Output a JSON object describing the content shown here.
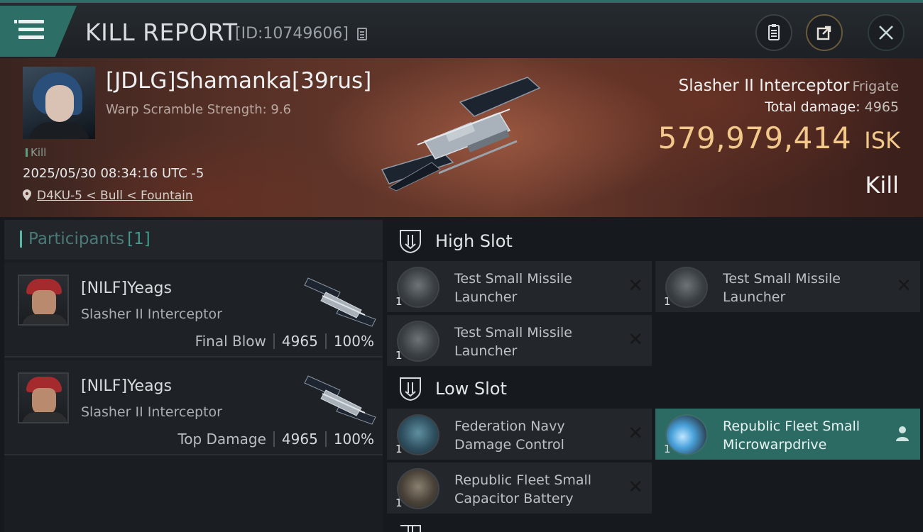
{
  "header": {
    "title": "KILL REPORT",
    "report_id": "[ID:10749606]",
    "icons": [
      "menu-icon",
      "copy-icon",
      "notes-icon",
      "share-icon",
      "close-icon"
    ]
  },
  "victim": {
    "name": "[JDLG]Shamanka[39rus]",
    "warp_scramble": "Warp Scramble Strength: 9.6",
    "kill_label": "Kill",
    "timestamp": "2025/05/30 08:34:16 UTC -5",
    "location": "D4KU-5 < Bull < Fountain"
  },
  "ship": {
    "name": "Slasher II Interceptor",
    "class": "Frigate",
    "total_damage_label": "Total damage:",
    "total_damage": "4965",
    "isk_value": "579,979,414",
    "isk_unit": "ISK",
    "kill_type": "Kill"
  },
  "participants": {
    "title": "Participants",
    "count": "[1]",
    "items": [
      {
        "name": "[NILF]Yeags",
        "ship": "Slasher II Interceptor",
        "role": "Final Blow",
        "damage": "4965",
        "percent": "100%"
      },
      {
        "name": "[NILF]Yeags",
        "ship": "Slasher II Interceptor",
        "role": "Top Damage",
        "damage": "4965",
        "percent": "100%"
      }
    ]
  },
  "slots": {
    "high": {
      "title": "High Slot",
      "modules": [
        {
          "qty": "1",
          "name": "Test Small Missile Launcher"
        },
        {
          "qty": "1",
          "name": "Test Small Missile Launcher"
        },
        {
          "qty": "1",
          "name": "Test Small Missile Launcher"
        }
      ]
    },
    "low": {
      "title": "Low Slot",
      "modules": [
        {
          "qty": "1",
          "name": "Federation Navy Damage Control"
        },
        {
          "qty": "1",
          "name": "Republic Fleet Small Microwarpdrive"
        },
        {
          "qty": "1",
          "name": "Republic Fleet Small Capacitor Battery"
        }
      ]
    }
  },
  "colors": {
    "accent_teal": "#2d6f67",
    "isk_gold": "#f3c98b",
    "active_module": "#2c6a64"
  }
}
